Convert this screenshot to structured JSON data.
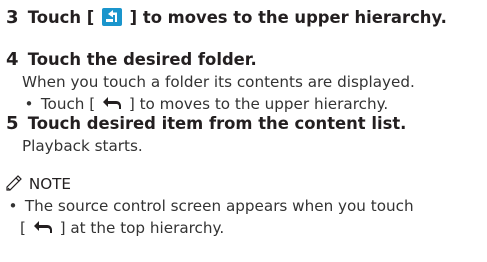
{
  "steps": [
    {
      "number": "3",
      "head_before": "Touch [",
      "head_after": "] to moves to the upper hierarchy."
    },
    {
      "number": "4",
      "head": "Touch the desired folder.",
      "body": "When you touch a folder its contents are displayed.",
      "bullet_before": "Touch [",
      "bullet_after": "] to moves to the upper hierarchy."
    },
    {
      "number": "5",
      "head": "Touch desired item from the content list.",
      "body": "Playback starts."
    }
  ],
  "note": {
    "label": "NOTE",
    "line1": "The source control screen appears when you touch",
    "line2_before": "[",
    "line2_after": "] at the top hierarchy."
  },
  "bullet_symbol": "•",
  "icons": {
    "upper_hierarchy": "up-hierarchy-icon",
    "back": "back-arrow-icon",
    "note": "note-pencil-icon"
  },
  "colors": {
    "icon_blue": "#1a95cc",
    "text": "#231f20"
  }
}
